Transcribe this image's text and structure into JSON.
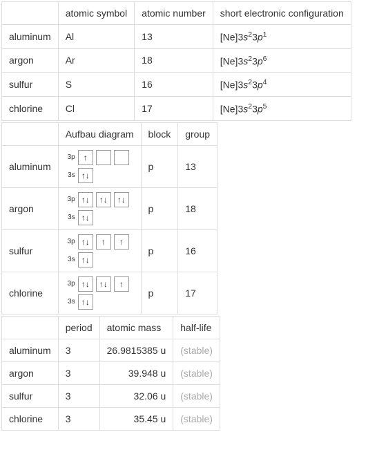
{
  "tables": {
    "t1": {
      "headers": {
        "atomic_symbol": "atomic symbol",
        "atomic_number": "atomic number",
        "short_config": "short electronic configuration"
      },
      "rows": [
        {
          "name": "aluminum",
          "symbol": "Al",
          "number": "13",
          "config_prefix": "[Ne]3",
          "config_s_exp": "2",
          "config_p_exp": "1"
        },
        {
          "name": "argon",
          "symbol": "Ar",
          "number": "18",
          "config_prefix": "[Ne]3",
          "config_s_exp": "2",
          "config_p_exp": "6"
        },
        {
          "name": "sulfur",
          "symbol": "S",
          "number": "16",
          "config_prefix": "[Ne]3",
          "config_s_exp": "2",
          "config_p_exp": "4"
        },
        {
          "name": "chlorine",
          "symbol": "Cl",
          "number": "17",
          "config_prefix": "[Ne]3",
          "config_s_exp": "2",
          "config_p_exp": "5"
        }
      ]
    },
    "t2": {
      "headers": {
        "aufbau": "Aufbau diagram",
        "block": "block",
        "group": "group"
      },
      "labels": {
        "3p": "3p",
        "3s": "3s"
      },
      "rows": [
        {
          "name": "aluminum",
          "p": [
            "↑",
            "",
            ""
          ],
          "s": [
            "↑↓"
          ],
          "block": "p",
          "group": "13"
        },
        {
          "name": "argon",
          "p": [
            "↑↓",
            "↑↓",
            "↑↓"
          ],
          "s": [
            "↑↓"
          ],
          "block": "p",
          "group": "18"
        },
        {
          "name": "sulfur",
          "p": [
            "↑↓",
            "↑",
            "↑"
          ],
          "s": [
            "↑↓"
          ],
          "block": "p",
          "group": "16"
        },
        {
          "name": "chlorine",
          "p": [
            "↑↓",
            "↑↓",
            "↑"
          ],
          "s": [
            "↑↓"
          ],
          "block": "p",
          "group": "17"
        }
      ]
    },
    "t3": {
      "headers": {
        "period": "period",
        "mass": "atomic mass",
        "halflife": "half-life"
      },
      "rows": [
        {
          "name": "aluminum",
          "period": "3",
          "mass": "26.9815385 u",
          "halflife": "(stable)"
        },
        {
          "name": "argon",
          "period": "3",
          "mass": "39.948 u",
          "halflife": "(stable)"
        },
        {
          "name": "sulfur",
          "period": "3",
          "mass": "32.06 u",
          "halflife": "(stable)"
        },
        {
          "name": "chlorine",
          "period": "3",
          "mass": "35.45 u",
          "halflife": "(stable)"
        }
      ]
    }
  }
}
